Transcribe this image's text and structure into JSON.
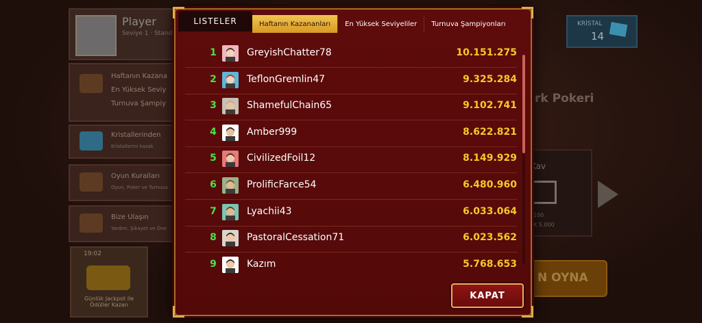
{
  "background": {
    "player_name": "Player",
    "player_level": "Seviye 1 · Standa",
    "crystal_label": "KRİSTAL",
    "crystal_value": "14",
    "menu": [
      {
        "label": "Haftanın Kazana",
        "sub": "En Yüksek Seviy",
        "sub2": "Turnuva Şampiy"
      },
      {
        "label": "Kristallerinden",
        "sub": "Kristallerini kazak"
      },
      {
        "label": "Oyun Kuralları",
        "sub": "Oyun, Poker ve Turnuva"
      },
      {
        "label": "Bize Ulaşın",
        "sub": "Yardım, Şikayet ve Öne"
      }
    ],
    "game_title": "rk Pokeri",
    "box_label": "Kav",
    "box_line1": "100",
    "box_line2": "K 5.000",
    "play_label": "N OYNA",
    "jackpot_time": "19:02",
    "jackpot_text": "Günlük Jackpot ile Ödüller Kazan"
  },
  "modal": {
    "title": "LISTELER",
    "tabs": [
      {
        "label": "Haftanın Kazananları",
        "active": true
      },
      {
        "label": "En Yüksek Seviyeliler",
        "active": false
      },
      {
        "label": "Turnuva Şampiyonları",
        "active": false
      }
    ],
    "rows": [
      {
        "rank": "1",
        "name": "GreyishChatter78",
        "score": "10.151.275",
        "avatar": "woman-pink-icon"
      },
      {
        "rank": "2",
        "name": "TeflonGremlin47",
        "score": "9.325.284",
        "avatar": "woman-redhair-icon"
      },
      {
        "rank": "3",
        "name": "ShamefulChain65",
        "score": "9.102.741",
        "avatar": "man-bald-icon"
      },
      {
        "rank": "4",
        "name": "Amber999",
        "score": "8.622.821",
        "avatar": "man-darkhair-icon"
      },
      {
        "rank": "5",
        "name": "CivilizedFoil12",
        "score": "8.149.929",
        "avatar": "woman-bun-icon"
      },
      {
        "rank": "6",
        "name": "ProlificFarce54",
        "score": "6.480.960",
        "avatar": "man-hat-icon"
      },
      {
        "rank": "7",
        "name": "Lyachii43",
        "score": "6.033.064",
        "avatar": "man-beard-icon"
      },
      {
        "rank": "8",
        "name": "PastoralCessation71",
        "score": "6.023.562",
        "avatar": "man-suit-icon"
      },
      {
        "rank": "9",
        "name": "Kazım",
        "score": "5.768.653",
        "avatar": "man-glasses-icon"
      }
    ],
    "close_label": "KAPAT"
  },
  "colors": {
    "modal_bg": "#5a0a0a",
    "border_gold": "#e0ac4e",
    "rank_green": "#4de04a",
    "score_yellow": "#f5c928",
    "active_tab": "#e5ae38"
  }
}
